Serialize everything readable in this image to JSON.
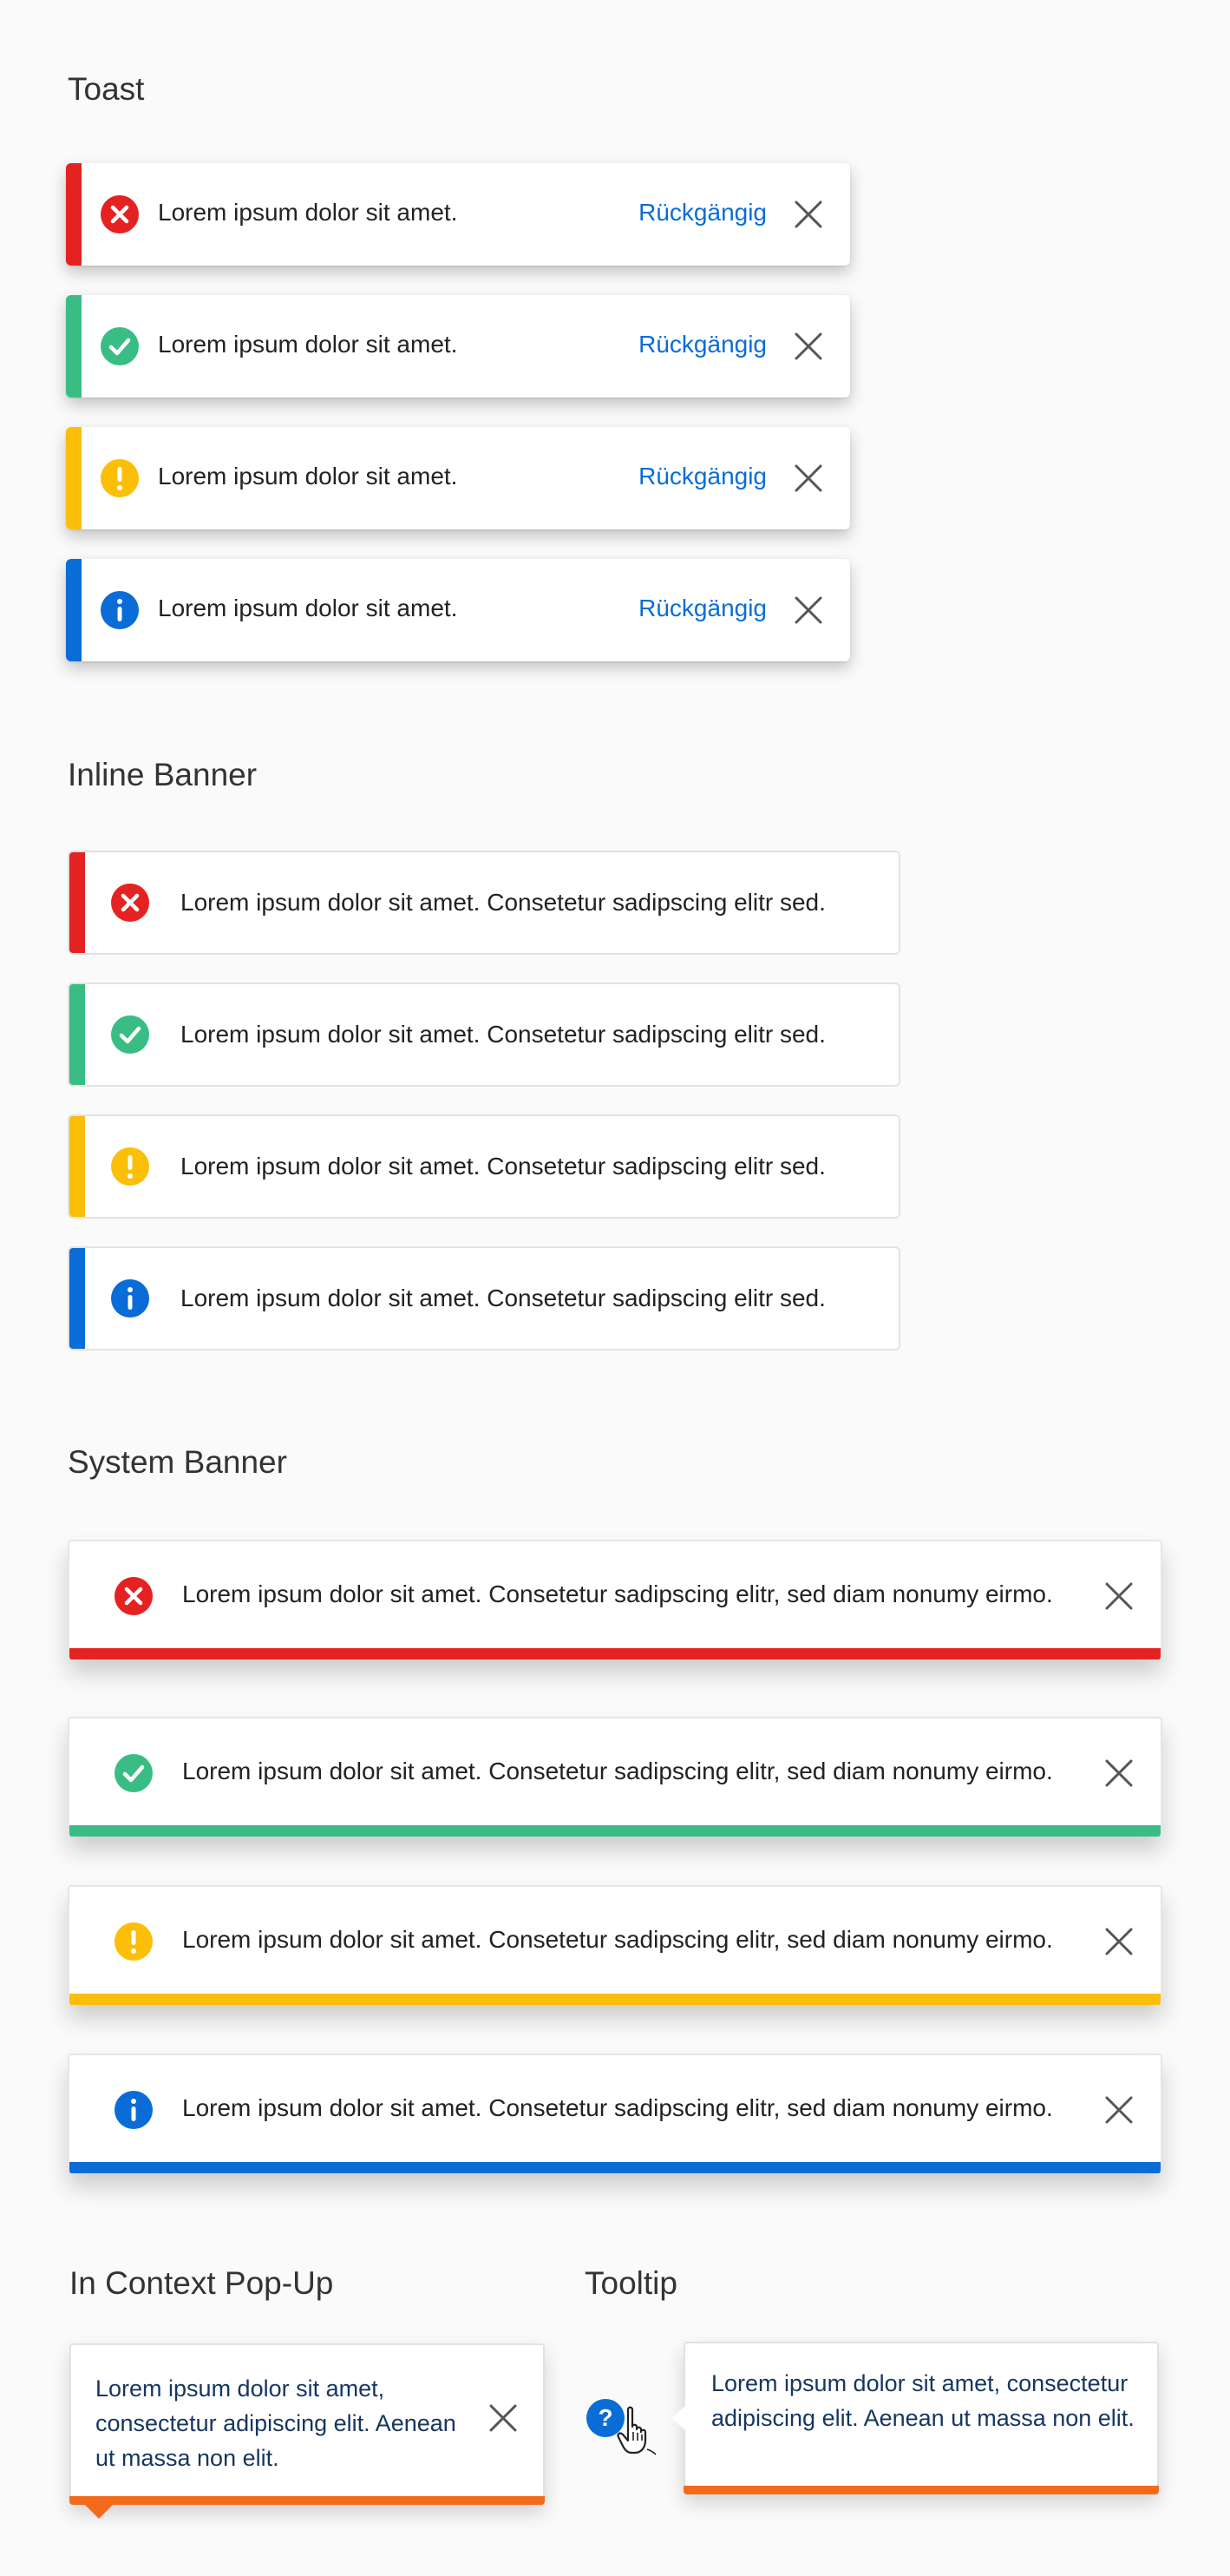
{
  "colors": {
    "error": "#e52222",
    "success": "#39bd85",
    "warning": "#fbbf09",
    "info": "#0a6cd6",
    "accent_orange": "#f26a1b",
    "link": "#0a6cd6"
  },
  "toast": {
    "title": "Toast",
    "items": [
      {
        "type": "error",
        "icon": "error-icon",
        "message": "Lorem ipsum dolor sit amet.",
        "action": "Rückgängig"
      },
      {
        "type": "success",
        "icon": "check-icon",
        "message": "Lorem ipsum dolor sit amet.",
        "action": "Rückgängig"
      },
      {
        "type": "warning",
        "icon": "warning-icon",
        "message": "Lorem ipsum dolor sit amet.",
        "action": "Rückgängig"
      },
      {
        "type": "info",
        "icon": "info-icon",
        "message": "Lorem ipsum dolor sit amet.",
        "action": "Rückgängig"
      }
    ]
  },
  "inline_banner": {
    "title": "Inline Banner",
    "items": [
      {
        "type": "error",
        "icon": "error-icon",
        "message": "Lorem ipsum dolor sit amet. Consetetur sadipscing elitr sed."
      },
      {
        "type": "success",
        "icon": "check-icon",
        "message": "Lorem ipsum dolor sit amet. Consetetur sadipscing elitr sed."
      },
      {
        "type": "warning",
        "icon": "warning-icon",
        "message": "Lorem ipsum dolor sit amet. Consetetur sadipscing elitr sed."
      },
      {
        "type": "info",
        "icon": "info-icon",
        "message": "Lorem ipsum dolor sit amet. Consetetur sadipscing elitr sed."
      }
    ]
  },
  "system_banner": {
    "title": "System Banner",
    "items": [
      {
        "type": "error",
        "icon": "error-icon",
        "message": "Lorem ipsum dolor sit amet. Consetetur sadipscing elitr, sed diam nonumy eirmo."
      },
      {
        "type": "success",
        "icon": "check-icon",
        "message": "Lorem ipsum dolor sit amet. Consetetur sadipscing elitr, sed diam nonumy eirmo."
      },
      {
        "type": "warning",
        "icon": "warning-icon",
        "message": "Lorem ipsum dolor sit amet. Consetetur sadipscing elitr, sed diam nonumy eirmo."
      },
      {
        "type": "info",
        "icon": "info-icon",
        "message": "Lorem ipsum dolor sit amet. Consetetur sadipscing elitr, sed diam nonumy eirmo."
      }
    ]
  },
  "popup": {
    "title": "In Context Pop-Up",
    "text": "Lorem ipsum dolor sit amet, consectetur adipiscing elit. Aenean ut massa non elit."
  },
  "tooltip": {
    "title": "Tooltip",
    "text": "Lorem ipsum dolor sit amet, consectetur adipiscing elit. Aenean ut massa non elit."
  }
}
